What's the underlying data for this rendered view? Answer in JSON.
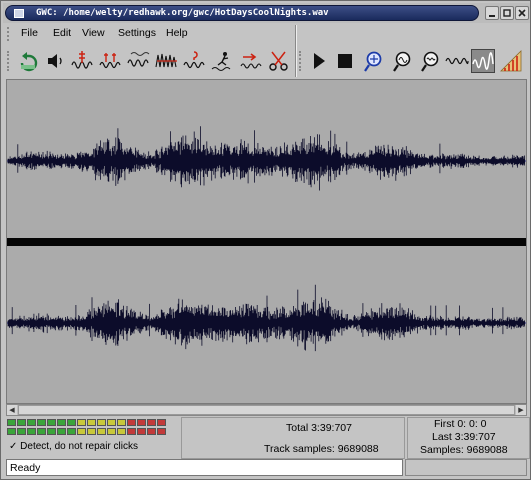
{
  "window": {
    "title": "GWC: /home/welty/redhawk.org/gwc/HotDaysCoolNights.wav"
  },
  "menubar": {
    "items": [
      "File",
      "Edit",
      "View",
      "Settings",
      "Help"
    ]
  },
  "toolbar": {
    "left_icons": [
      "undo-icon",
      "speaker-icon",
      "declick-strong-icon",
      "declick-icon",
      "declick-weak-icon",
      "noise-sample-icon",
      "denoise-icon",
      "mark-click-icon",
      "amplify-icon",
      "cut-icon"
    ],
    "right_icons": [
      "play-icon",
      "stop-icon",
      "zoom-select-icon",
      "zoom-in-icon",
      "zoom-out-icon",
      "view-all-icon",
      "spectral-icon",
      "estimate-icon"
    ]
  },
  "status": {
    "total_label": "Total 3:39:707",
    "track_samples_label": "Track samples: 9689088",
    "first_label": "First 0: 0:  0",
    "last_label": "Last 3:39:707",
    "samples_label": "Samples: 9689088",
    "mode_check_label": "✓ Detect, do not repair clicks",
    "statusbar_text": "Ready"
  }
}
